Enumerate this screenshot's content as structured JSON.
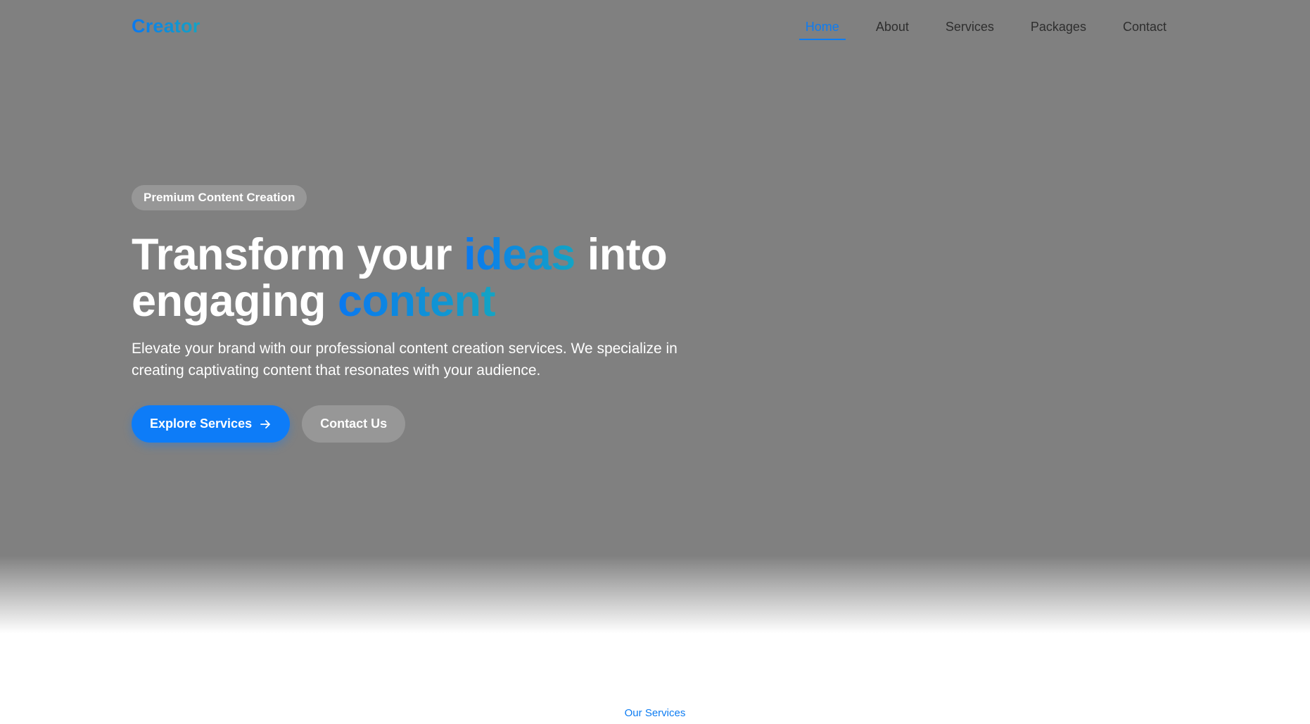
{
  "nav": {
    "brand": "Creator",
    "links": [
      {
        "label": "Home",
        "active": true
      },
      {
        "label": "About",
        "active": false
      },
      {
        "label": "Services",
        "active": false
      },
      {
        "label": "Packages",
        "active": false
      },
      {
        "label": "Contact",
        "active": false
      }
    ]
  },
  "hero": {
    "badge": "Premium Content Creation",
    "headline": {
      "part1": "Transform your ",
      "highlight1": "ideas",
      "part2": " into",
      "part3": "engaging ",
      "highlight2": "content"
    },
    "lede": "Elevate your brand with our professional content creation services. We specialize in creating captivating content that resonates with your audience.",
    "primary_button": "Explore Services",
    "primary_button_icon": "arrow-right-icon",
    "secondary_button": "Contact Us"
  },
  "services": {
    "eyebrow": "Our Services"
  },
  "colors": {
    "accent": "#0d7cf2",
    "accent_gradient_end": "#13a4c4",
    "hero_overlay": "#808080",
    "badge_bg": "#979797",
    "nav_text": "#2e2e2e"
  }
}
